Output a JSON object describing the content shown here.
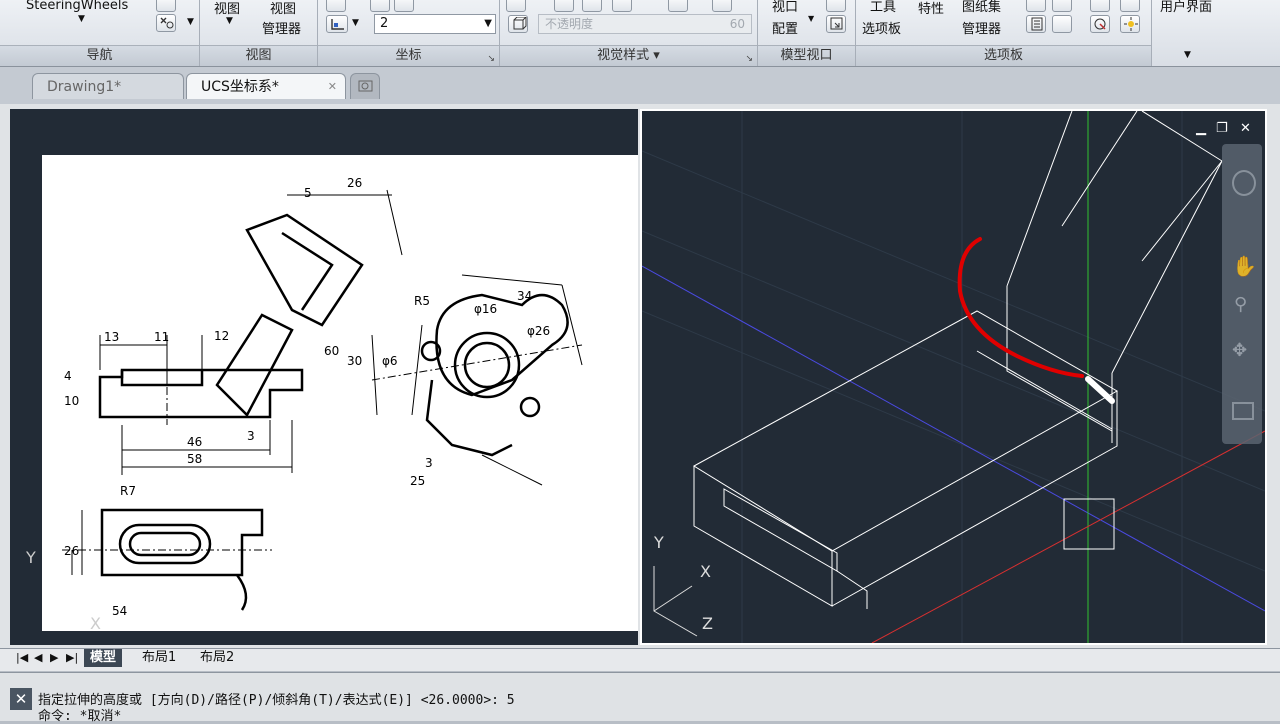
{
  "ribbon": {
    "navigation": {
      "title": "导航",
      "steering": "SteeringWheels"
    },
    "view": {
      "title": "视图",
      "btn1": "视图",
      "btn2_line1": "视图",
      "btn2_line2": "管理器"
    },
    "coords": {
      "title": "坐标",
      "value": "2"
    },
    "visual_styles": {
      "title": "视觉样式 ▾",
      "opacity_label": "不透明度",
      "opacity_value": "60"
    },
    "model_viewports": {
      "title": "模型视口",
      "btn_line1": "视口",
      "btn_line2": "配置"
    },
    "palettes": {
      "title": "选项板",
      "tool_line1": "工具",
      "tool_line2": "选项板",
      "properties": "特性",
      "sheet_line1": "图纸集",
      "sheet_line2": "管理器"
    },
    "user_interface": {
      "label": "用户界面"
    }
  },
  "tabs": [
    {
      "label": "Drawing1*"
    },
    {
      "label": "UCS坐标系*"
    }
  ],
  "drawing": {
    "dims": [
      "13",
      "11",
      "4",
      "10",
      "46",
      "58",
      "3",
      "26",
      "5",
      "12",
      "60",
      "30",
      "R5",
      "34",
      "φ16",
      "φ26",
      "φ6",
      "3",
      "25",
      "R7",
      "26",
      "54"
    ]
  },
  "ucs_left": {
    "y": "Y",
    "x": "X"
  },
  "ucs_right": {
    "y": "Y",
    "x": "X",
    "z": "Z"
  },
  "layout_tabs": [
    {
      "label": "模型"
    },
    {
      "label": "布局1"
    },
    {
      "label": "布局2"
    }
  ],
  "command": {
    "line1": "指定拉伸的高度或 [方向(D)/路径(P)/倾斜角(T)/表达式(E)] <26.0000>: 5",
    "line2": "命令: *取消*"
  },
  "colors": {
    "viewport_bg": "#222b36",
    "x_axis": "#e03030",
    "y_axis": "#30c030",
    "z_axis": "#4040e0",
    "annotation": "#e00000"
  }
}
